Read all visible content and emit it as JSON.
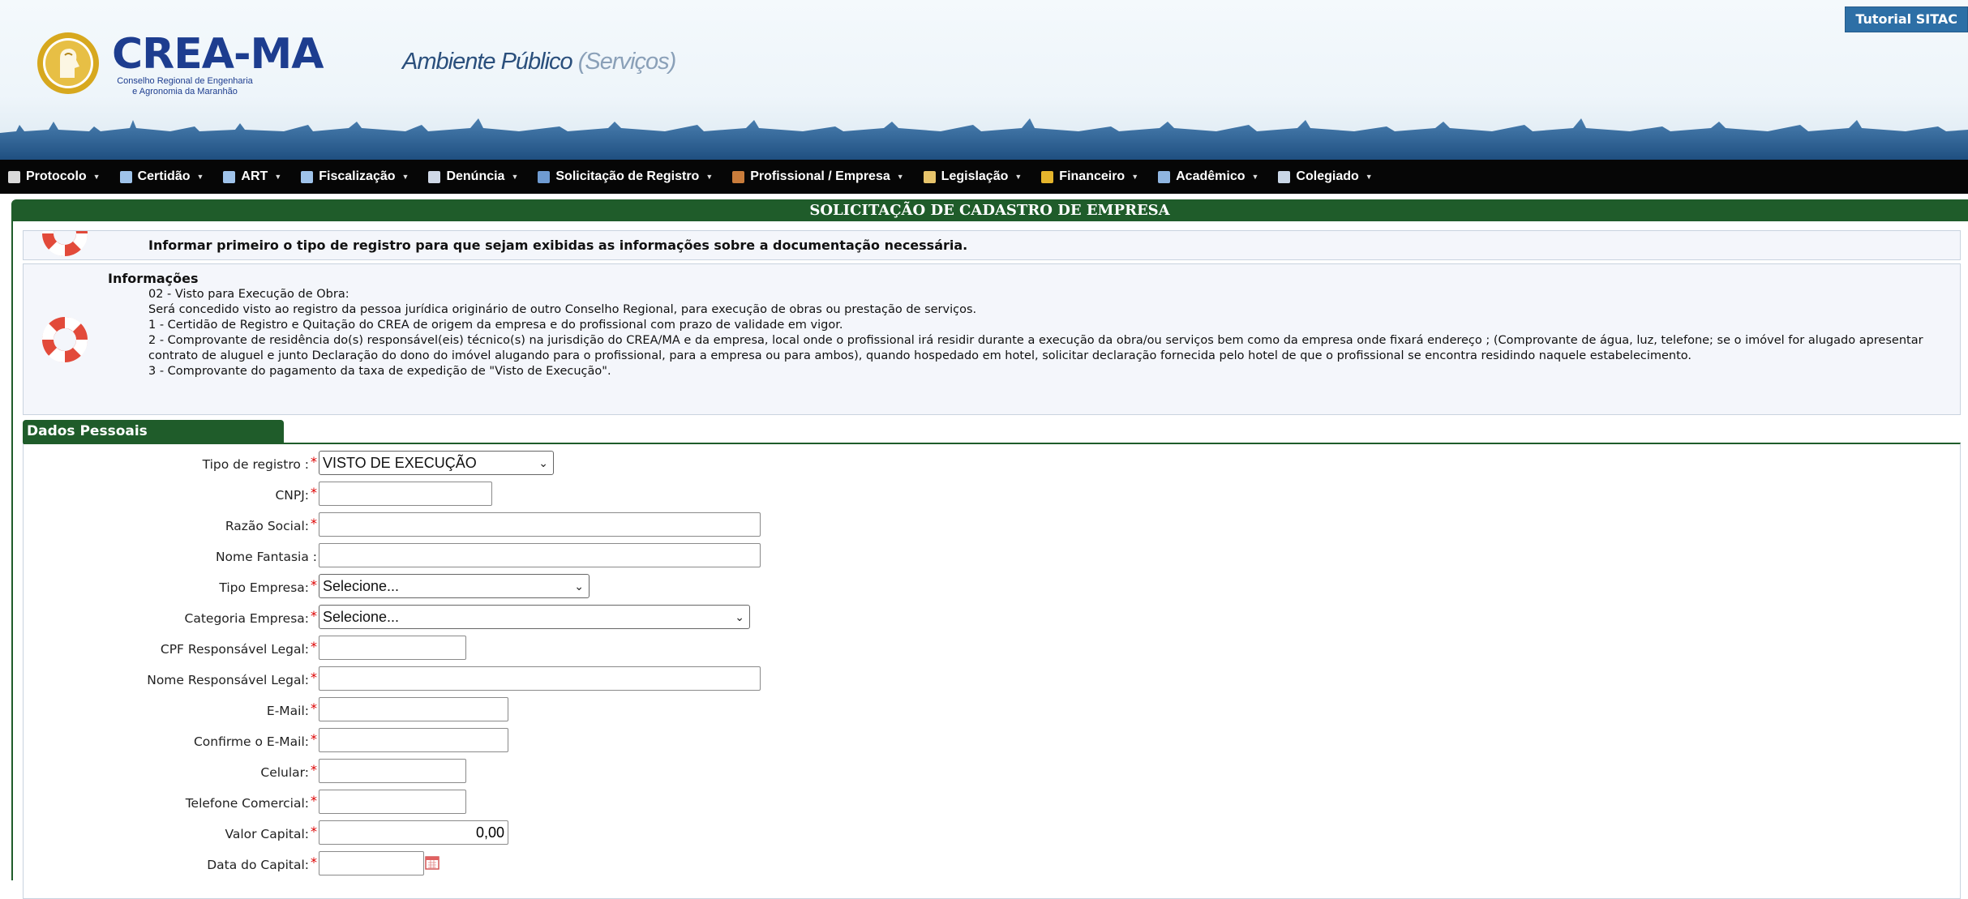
{
  "header": {
    "tutorial_label": "Tutorial SITAC",
    "logo_title": "CREA-MA",
    "logo_sub_1": "Conselho Regional de Engenharia",
    "logo_sub_2": "e Agronomia da Maranhão",
    "ambiente": "Ambiente Público",
    "servicos": "(Serviços)"
  },
  "nav": [
    {
      "label": "Protocolo",
      "icon": "tag-icon",
      "color": "#d9d9d9"
    },
    {
      "label": "Certidão",
      "icon": "document-icon",
      "color": "#9fc3ea"
    },
    {
      "label": "ART",
      "icon": "document-icon",
      "color": "#9fc3ea"
    },
    {
      "label": "Fiscalização",
      "icon": "document-icon",
      "color": "#9fc3ea"
    },
    {
      "label": "Denúncia",
      "icon": "form-icon",
      "color": "#cfd8e6"
    },
    {
      "label": "Solicitação de Registro",
      "icon": "person-icon",
      "color": "#6f9bd1"
    },
    {
      "label": "Profissional / Empresa",
      "icon": "address-book-icon",
      "color": "#c97c3b"
    },
    {
      "label": "Legislação",
      "icon": "books-icon",
      "color": "#e7c46b"
    },
    {
      "label": "Financeiro",
      "icon": "coins-icon",
      "color": "#e5b52c"
    },
    {
      "label": "Acadêmico",
      "icon": "open-book-icon",
      "color": "#8fb5e0"
    },
    {
      "label": "Colegiado",
      "icon": "chat-icon",
      "color": "#c9d6e6"
    }
  ],
  "page_title": "SOLICITAÇÃO DE CADASTRO DE EMPRESA",
  "notice": "Informar primeiro o tipo de registro para que sejam exibidas as informações sobre a documentação necessária.",
  "info": {
    "title": "Informações",
    "lines": [
      "02 - Visto para Execução de Obra:",
      "Será concedido visto ao registro da pessoa jurídica originário de outro Conselho Regional, para execução de obras ou prestação de serviços.",
      "1 - Certidão de Registro e Quitação do CREA de origem da empresa e do profissional com prazo de validade em vigor.",
      "2 - Comprovante de residência do(s) responsável(eis) técnico(s) na jurisdição do CREA/MA e da empresa, local onde o profissional irá residir durante a execução da obra/ou serviços bem como da empresa onde fixará endereço ; (Comprovante de água, luz, telefone; se o imóvel for alugado apresentar contrato de aluguel e junto Declaração do dono do imóvel alugando para o profissional, para a empresa ou para ambos), quando hospedado em hotel, solicitar declaração fornecida pelo hotel de que o profissional se encontra residindo naquele estabelecimento.",
      "3 - Comprovante do pagamento da taxa de expedição de \"Visto de Execução\"."
    ]
  },
  "tab_label": "Dados Pessoais",
  "form": {
    "tipo_registro_label": "Tipo de registro :",
    "tipo_registro_value": "VISTO DE EXECUÇÃO",
    "cnpj_label": "CNPJ:",
    "razao_label": "Razão Social:",
    "fantasia_label": "Nome Fantasia :",
    "tipo_empresa_label": "Tipo Empresa:",
    "tipo_empresa_value": "Selecione...",
    "categoria_label": "Categoria Empresa:",
    "categoria_value": "Selecione...",
    "cpf_label": "CPF Responsável Legal:",
    "nome_resp_label": "Nome Responsável Legal:",
    "email_label": "E-Mail:",
    "confirme_label": "Confirme o E-Mail:",
    "celular_label": "Celular:",
    "telefone_label": "Telefone Comercial:",
    "valor_label": "Valor Capital:",
    "valor_value": "0,00",
    "data_label": "Data do Capital:",
    "required_mark": "*"
  }
}
